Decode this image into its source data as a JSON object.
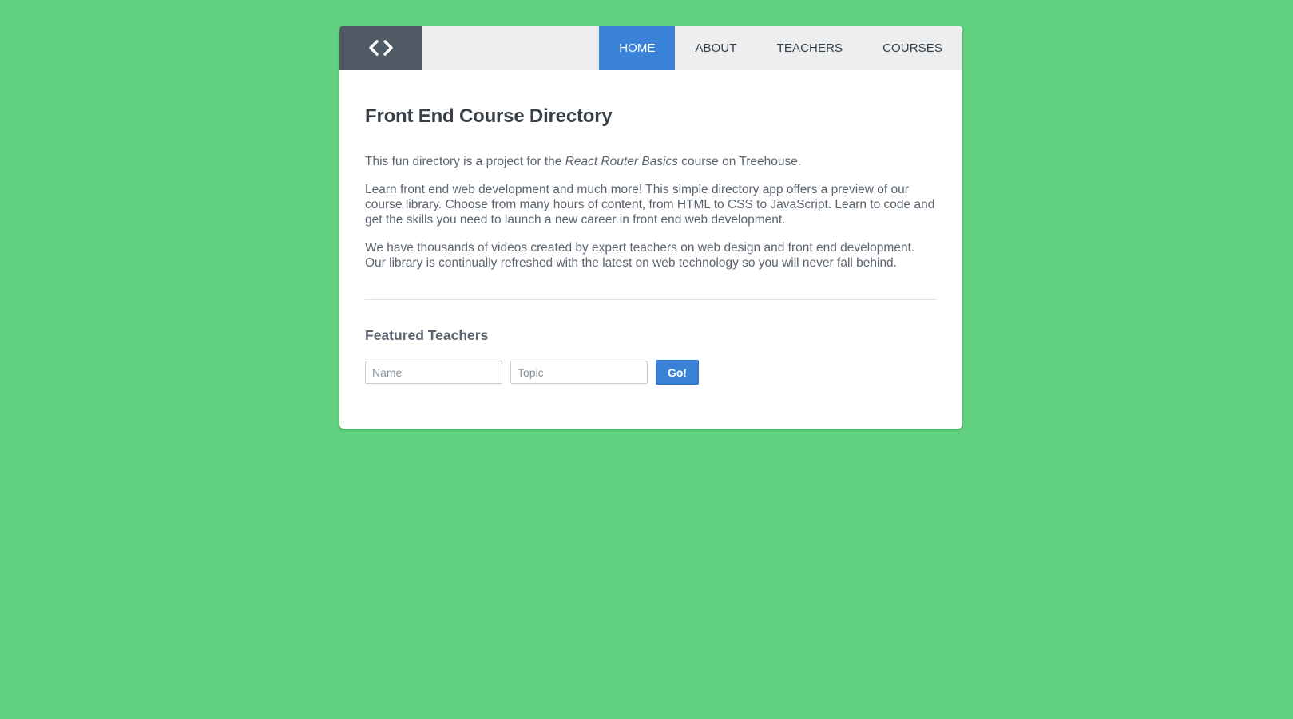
{
  "colors": {
    "background": "#61d180",
    "accent": "#3a82d8",
    "logo_bg": "#4f5a64",
    "header_bg": "#edeef0"
  },
  "header": {
    "logo_icon": "code-brackets-icon",
    "nav": [
      {
        "label": "HOME",
        "active": true
      },
      {
        "label": "ABOUT",
        "active": false
      },
      {
        "label": "TEACHERS",
        "active": false
      },
      {
        "label": "COURSES",
        "active": false
      }
    ]
  },
  "main": {
    "title": "Front End Course Directory",
    "intro_before": "This fun directory is a project for the ",
    "intro_emphasis": "React Router Basics",
    "intro_after": " course on Treehouse.",
    "paragraph_1": "Learn front end web development and much more! This simple directory app offers a preview of our course library. Choose from many hours of content, from HTML to CSS to JavaScript. Learn to code and get the skills you need to launch a new career in front end web development.",
    "paragraph_2": "We have thousands of videos created by expert teachers on web design and front end development. Our library is continually refreshed with the latest on web technology so you will never fall behind."
  },
  "featured": {
    "heading": "Featured Teachers",
    "name_placeholder": "Name",
    "topic_placeholder": "Topic",
    "submit_label": "Go!"
  }
}
